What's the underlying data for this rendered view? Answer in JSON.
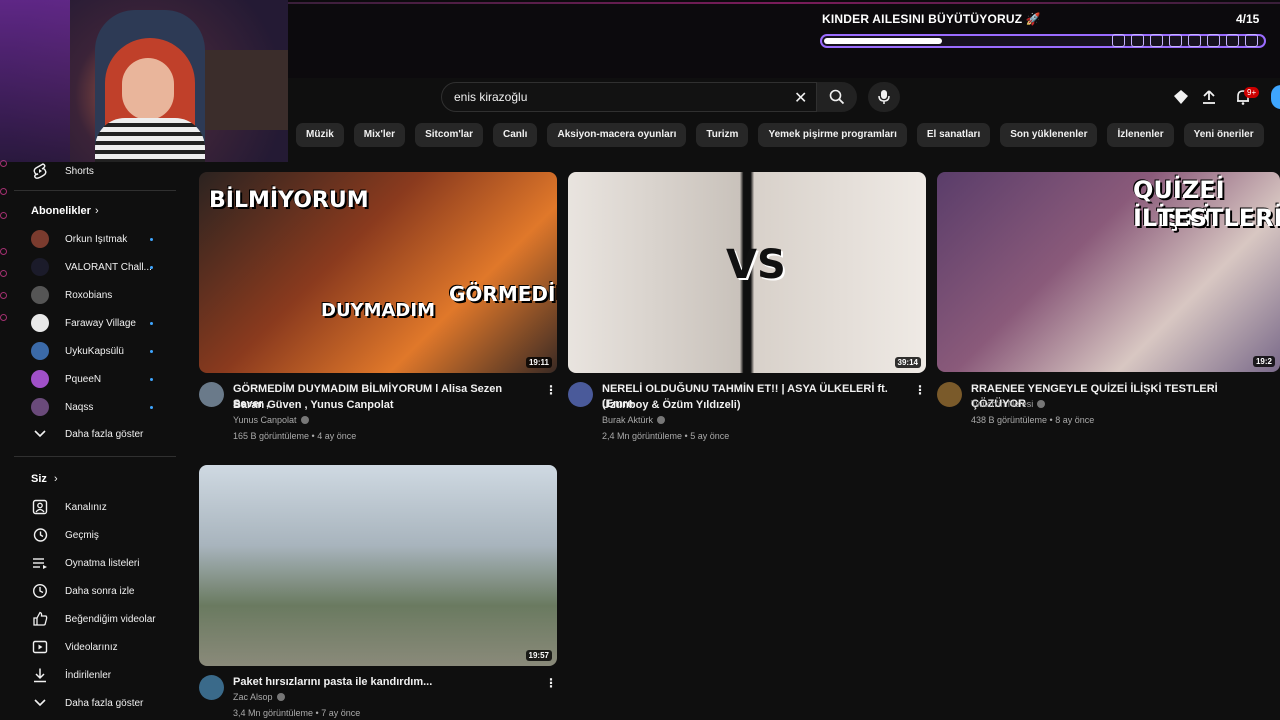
{
  "overlay": {
    "goal_title": "KINDER AILESINI BÜYÜTÜYORUZ 🚀",
    "goal_count": "4/15",
    "goal_progress": 0.27
  },
  "search": {
    "query": "enis kirazoğlu"
  },
  "notifications_badge": "9+",
  "chips": [
    "Müzik",
    "Mix'ler",
    "Sitcom'lar",
    "Canlı",
    "Aksiyon-macera oyunları",
    "Turizm",
    "Yemek pişirme programları",
    "El sanatları",
    "Son yüklenenler",
    "İzlenenler",
    "Yeni öneriler"
  ],
  "sidebar": {
    "shorts": "Shorts",
    "subscriptions_header": "Abonelikler",
    "channels": [
      {
        "name": "Orkun Işıtmak",
        "color": "#7a3b2e",
        "dot": true
      },
      {
        "name": "VALORANT Chall...",
        "color": "#1b1b2a",
        "dot": true
      },
      {
        "name": "Roxobians",
        "color": "#555555",
        "dot": false
      },
      {
        "name": "Faraway Village",
        "color": "#e8e8e8",
        "dot": true
      },
      {
        "name": "UykuKapsülü",
        "color": "#3b6aa8",
        "dot": true
      },
      {
        "name": "PqueeN",
        "color": "#a050c8",
        "dot": true
      },
      {
        "name": "Naqss",
        "color": "#6a4a7a",
        "dot": true
      }
    ],
    "show_more": "Daha fazla göster",
    "you_header": "Siz",
    "you_items": [
      "Kanalınız",
      "Geçmiş",
      "Oynatma listeleri",
      "Daha sonra izle",
      "Beğendiğim videolar",
      "Videolarınız",
      "İndirilenler",
      "Daha fazla göster"
    ]
  },
  "videos": [
    {
      "title_line1": "GÖRMEDİM DUYMADIM BİLMİYORUM l Alisa Sezen Sever ,",
      "title_line2": "Baran Güven , Yunus Canpolat",
      "channel": "Yunus Canpolat",
      "stats": "165 B görüntüleme • 4 ay önce",
      "duration": "19:11",
      "thumb_words": [
        "BİLMİYORUM",
        "DUYMADIM",
        "GÖRMEDİM"
      ]
    },
    {
      "title_line1": "NERELİ OLDUĞUNU TAHMİN ET!! | ASYA ÜLKELERİ ft. (Emre",
      "title_line2": "Uzunboy & Özüm Yıldızeli)",
      "channel": "Burak Aktürk",
      "stats": "2,4 Mn görüntüleme • 5 ay önce",
      "duration": "39:14",
      "thumb_words": [
        "VS"
      ]
    },
    {
      "title_line1": "RRAENEE YENGEYLE QUİZEİ İLİŞKİ TESTLERİ ÇÖZÜYOR",
      "title_line2": "",
      "channel": "Twitch'in Nefesi",
      "stats": "438 B görüntüleme • 8 ay önce",
      "duration": "19:2",
      "thumb_words": [
        "QUİZEİ İLİŞKİ",
        "TESTLERİ"
      ]
    },
    {
      "title_line1": "Paket hırsızlarını pasta ile kandırdım...",
      "title_line2": "",
      "channel": "Zac Alsop",
      "stats": "3,4 Mn görüntüleme • 7 ay önce",
      "duration": "19:57",
      "thumb_words": []
    }
  ]
}
